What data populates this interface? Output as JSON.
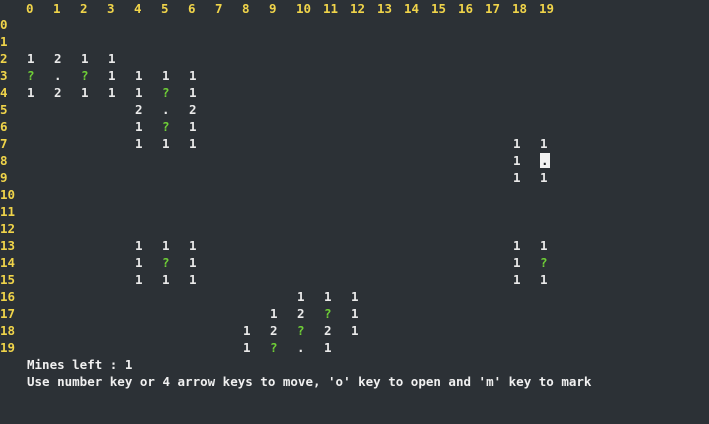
{
  "colors": {
    "background": "#2c3136",
    "header": "#f0d44a",
    "unknown_marker": "#6fcf36",
    "text": "#eaeaea"
  },
  "columns": [
    "0",
    "1",
    "2",
    "3",
    "4",
    "5",
    "6",
    "7",
    "8",
    "9",
    "10",
    "11",
    "12",
    "13",
    "14",
    "15",
    "16",
    "17",
    "18",
    "19"
  ],
  "rows": [
    "0",
    "1",
    "2",
    "3",
    "4",
    "5",
    "6",
    "7",
    "8",
    "9",
    "10",
    "11",
    "12",
    "13",
    "14",
    "15",
    "16",
    "17",
    "18",
    "19"
  ],
  "cursor": {
    "row": 8,
    "col": 19,
    "symbol": "."
  },
  "cells": [
    {
      "r": 2,
      "c": 0,
      "v": "1"
    },
    {
      "r": 2,
      "c": 1,
      "v": "2"
    },
    {
      "r": 2,
      "c": 2,
      "v": "1"
    },
    {
      "r": 2,
      "c": 3,
      "v": "1"
    },
    {
      "r": 3,
      "c": 0,
      "v": "?"
    },
    {
      "r": 3,
      "c": 1,
      "v": "."
    },
    {
      "r": 3,
      "c": 2,
      "v": "?"
    },
    {
      "r": 3,
      "c": 3,
      "v": "1"
    },
    {
      "r": 3,
      "c": 4,
      "v": "1"
    },
    {
      "r": 3,
      "c": 5,
      "v": "1"
    },
    {
      "r": 3,
      "c": 6,
      "v": "1"
    },
    {
      "r": 4,
      "c": 0,
      "v": "1"
    },
    {
      "r": 4,
      "c": 1,
      "v": "2"
    },
    {
      "r": 4,
      "c": 2,
      "v": "1"
    },
    {
      "r": 4,
      "c": 3,
      "v": "1"
    },
    {
      "r": 4,
      "c": 4,
      "v": "1"
    },
    {
      "r": 4,
      "c": 5,
      "v": "?"
    },
    {
      "r": 4,
      "c": 6,
      "v": "1"
    },
    {
      "r": 5,
      "c": 4,
      "v": "2"
    },
    {
      "r": 5,
      "c": 5,
      "v": "."
    },
    {
      "r": 5,
      "c": 6,
      "v": "2"
    },
    {
      "r": 6,
      "c": 4,
      "v": "1"
    },
    {
      "r": 6,
      "c": 5,
      "v": "?"
    },
    {
      "r": 6,
      "c": 6,
      "v": "1"
    },
    {
      "r": 7,
      "c": 4,
      "v": "1"
    },
    {
      "r": 7,
      "c": 5,
      "v": "1"
    },
    {
      "r": 7,
      "c": 6,
      "v": "1"
    },
    {
      "r": 7,
      "c": 18,
      "v": "1"
    },
    {
      "r": 7,
      "c": 19,
      "v": "1"
    },
    {
      "r": 8,
      "c": 18,
      "v": "1"
    },
    {
      "r": 8,
      "c": 19,
      "v": "."
    },
    {
      "r": 9,
      "c": 18,
      "v": "1"
    },
    {
      "r": 9,
      "c": 19,
      "v": "1"
    },
    {
      "r": 13,
      "c": 4,
      "v": "1"
    },
    {
      "r": 13,
      "c": 5,
      "v": "1"
    },
    {
      "r": 13,
      "c": 6,
      "v": "1"
    },
    {
      "r": 13,
      "c": 18,
      "v": "1"
    },
    {
      "r": 13,
      "c": 19,
      "v": "1"
    },
    {
      "r": 14,
      "c": 4,
      "v": "1"
    },
    {
      "r": 14,
      "c": 5,
      "v": "?"
    },
    {
      "r": 14,
      "c": 6,
      "v": "1"
    },
    {
      "r": 14,
      "c": 18,
      "v": "1"
    },
    {
      "r": 14,
      "c": 19,
      "v": "?"
    },
    {
      "r": 15,
      "c": 4,
      "v": "1"
    },
    {
      "r": 15,
      "c": 5,
      "v": "1"
    },
    {
      "r": 15,
      "c": 6,
      "v": "1"
    },
    {
      "r": 15,
      "c": 18,
      "v": "1"
    },
    {
      "r": 15,
      "c": 19,
      "v": "1"
    },
    {
      "r": 16,
      "c": 10,
      "v": "1"
    },
    {
      "r": 16,
      "c": 11,
      "v": "1"
    },
    {
      "r": 16,
      "c": 12,
      "v": "1"
    },
    {
      "r": 17,
      "c": 9,
      "v": "1"
    },
    {
      "r": 17,
      "c": 10,
      "v": "2"
    },
    {
      "r": 17,
      "c": 11,
      "v": "?"
    },
    {
      "r": 17,
      "c": 12,
      "v": "1"
    },
    {
      "r": 18,
      "c": 8,
      "v": "1"
    },
    {
      "r": 18,
      "c": 9,
      "v": "2"
    },
    {
      "r": 18,
      "c": 10,
      "v": "?"
    },
    {
      "r": 18,
      "c": 11,
      "v": "2"
    },
    {
      "r": 18,
      "c": 12,
      "v": "1"
    },
    {
      "r": 19,
      "c": 8,
      "v": "1"
    },
    {
      "r": 19,
      "c": 9,
      "v": "?"
    },
    {
      "r": 19,
      "c": 10,
      "v": "."
    },
    {
      "r": 19,
      "c": 11,
      "v": "1"
    }
  ],
  "status": {
    "mines_left_label": "Mines left : 1",
    "instructions": "Use number key or 4 arrow keys to move, 'o' key to open and 'm' key to mark"
  }
}
